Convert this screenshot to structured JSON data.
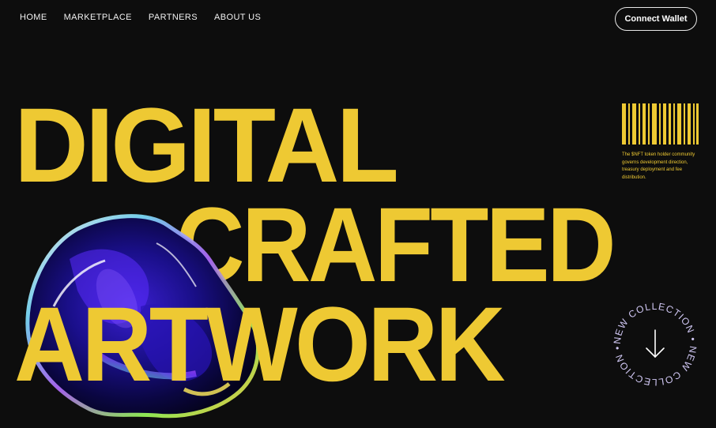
{
  "nav": {
    "items": [
      "HOME",
      "MARKETPLACE",
      "PARTNERS",
      "ABOUT US"
    ]
  },
  "header": {
    "connect_label": "Connect Wallet"
  },
  "hero": {
    "line1": "DIGITAL",
    "line2": "CRAFTED",
    "line3": "ARTWORK"
  },
  "sidebar": {
    "blurb": "The $NFT token holder community governs development direction, treasury deployment and fee distribution."
  },
  "badge": {
    "text": "NEW COLLECTION • NEW COLLECTION •"
  },
  "colors": {
    "background": "#0d0d0d",
    "accent": "#eec933",
    "badge_text": "#cfc6f2",
    "text": "#f2f2f2"
  },
  "icons": {
    "badge_arrow": "arrow-down-icon",
    "barcode": "barcode-icon",
    "artwork": "iridescent-glass-blob"
  }
}
